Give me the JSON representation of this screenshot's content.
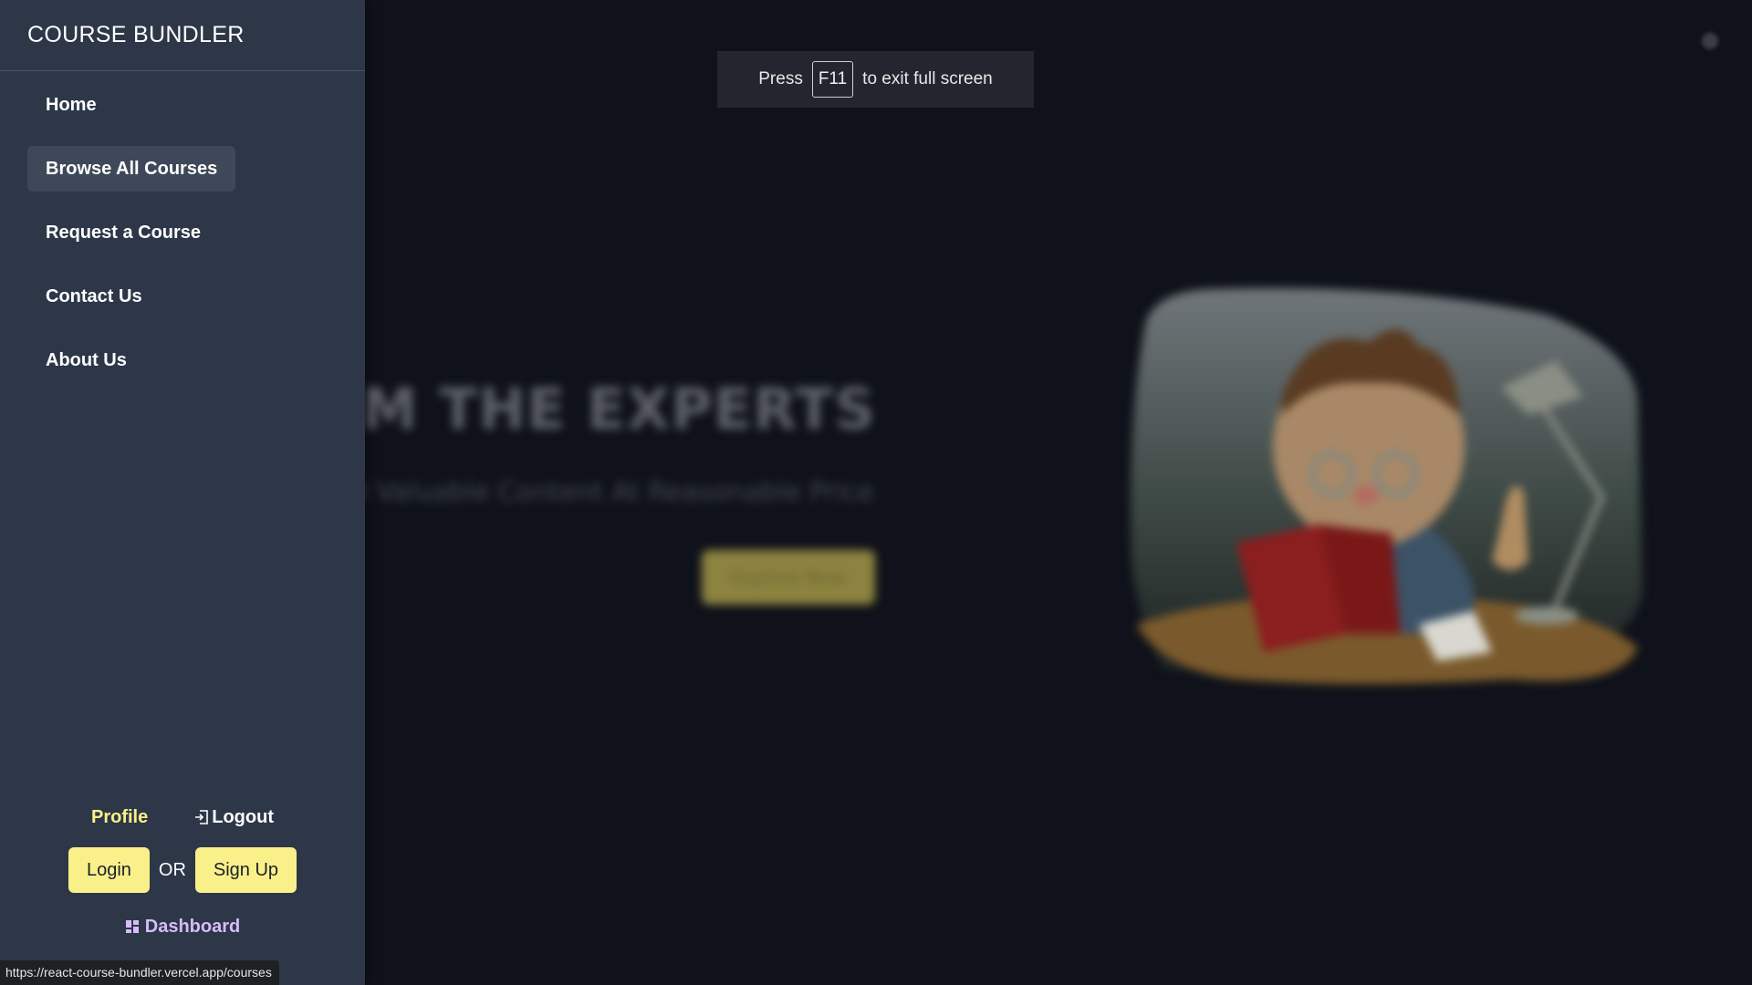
{
  "sidebar": {
    "brand": "COURSE BUNDLER",
    "items": [
      {
        "label": "Home",
        "active": false
      },
      {
        "label": "Browse All Courses",
        "active": true
      },
      {
        "label": "Request a Course",
        "active": false
      },
      {
        "label": "Contact Us",
        "active": false
      },
      {
        "label": "About Us",
        "active": false
      }
    ],
    "profile_label": "Profile",
    "logout_label": "Logout",
    "login_label": "Login",
    "or_label": "OR",
    "signup_label": "Sign Up",
    "dashboard_label": "Dashboard",
    "logout_icon": "logout-icon",
    "dashboard_icon": "dashboard-grid-icon"
  },
  "fullscreen_notice": {
    "press": "Press",
    "key": "F11",
    "suffix": "to exit full screen"
  },
  "hero": {
    "heading": "FROM THE EXPERTS",
    "subheading": "nd Valuable Content At Reasonable Price",
    "button_label": "Explore Now"
  },
  "status_bar": {
    "url": "https://react-course-bundler.vercel.app/courses"
  },
  "colors": {
    "drawer_bg": "#2d3748",
    "accent_yellow": "#faf089",
    "dashboard_purple": "#d6bcfa",
    "page_bg": "#0f121a"
  }
}
